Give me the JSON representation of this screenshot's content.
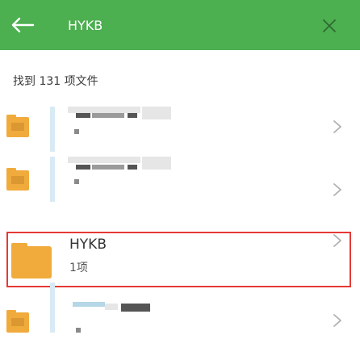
{
  "header": {
    "back_icon": "arrow-left-icon",
    "search_value": "HYKB",
    "clear_icon": "close-icon",
    "background_color": "#4caf50"
  },
  "results": {
    "count_label": "找到 131 项文件"
  },
  "list": {
    "items": [
      {
        "title": "",
        "subtitle": "",
        "icon": "folder-icon",
        "obscured": true
      },
      {
        "title": "",
        "subtitle": "",
        "icon": "folder-icon",
        "obscured": true
      },
      {
        "title": "HYKB",
        "subtitle": "1项",
        "icon": "folder-icon",
        "highlighted": true
      },
      {
        "title": "",
        "subtitle": "",
        "icon": "folder-icon",
        "obscured": true
      }
    ]
  },
  "colors": {
    "folder": "#f0ab3c",
    "highlight_border": "#e53935",
    "chevron": "#b0b0b0"
  }
}
